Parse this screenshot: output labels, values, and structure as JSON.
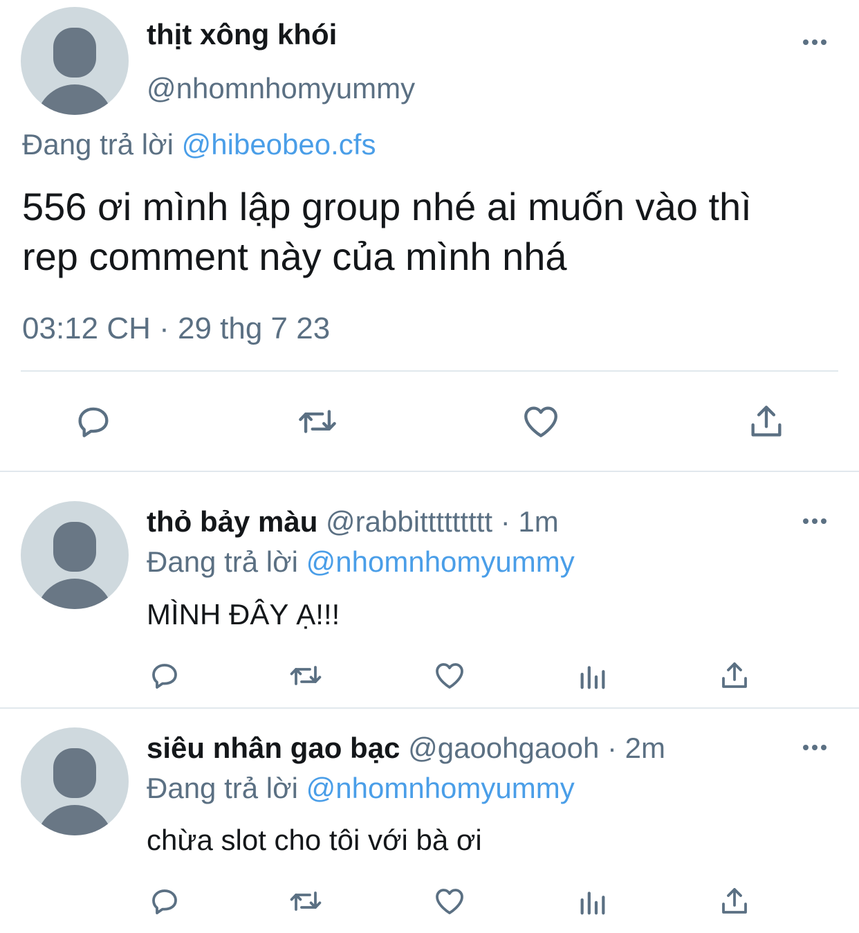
{
  "main_tweet": {
    "display_name": "thịt xông khói",
    "handle": "@nhomnhomyummy",
    "reply_prefix": "Đang trả lời",
    "reply_to": "@hibeobeo.cfs",
    "text_line1": "556 ơi mình lập group nhé ai muốn vào thì",
    "text_line2": "rep comment này của mình nhá",
    "timestamp": "03:12 CH · 29 thg 7 23"
  },
  "replies": [
    {
      "display_name": "thỏ bảy màu",
      "handle": "@rabbittttttttt",
      "time": "· 1m",
      "reply_prefix": "Đang trả lời",
      "reply_to": "@nhomnhomyummy",
      "text": "MÌNH ĐÂY Ạ!!!"
    },
    {
      "display_name": "siêu nhân gao bạc",
      "handle": "@gaoohgaooh",
      "time": "· 2m",
      "reply_prefix": "Đang trả lời",
      "reply_to": "@nhomnhomyummy",
      "text": "chừa slot cho tôi với bà ơi"
    }
  ],
  "colors": {
    "text": "#14171a",
    "muted": "#5b7083",
    "link": "#4a9ee8",
    "divider": "#e1e8ed",
    "avatar_bg": "#cfd9de",
    "avatar_fg": "#697785"
  },
  "icons": [
    "reply-icon",
    "retweet-icon",
    "like-icon",
    "share-icon",
    "analytics-icon",
    "more-icon"
  ]
}
